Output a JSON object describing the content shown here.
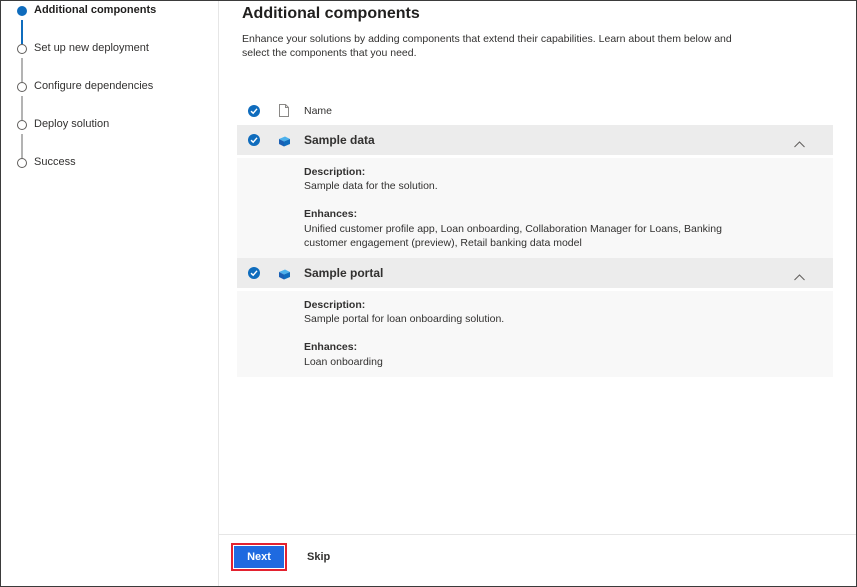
{
  "steps": [
    {
      "label": "Additional components",
      "state": "active"
    },
    {
      "label": "Set up new deployment",
      "state": "pending"
    },
    {
      "label": "Configure dependencies",
      "state": "pending"
    },
    {
      "label": "Deploy solution",
      "state": "pending"
    },
    {
      "label": "Success",
      "state": "pending"
    }
  ],
  "main": {
    "title": "Additional components",
    "description": "Enhance your solutions by adding components that extend their capabilities. Learn about them below and select the components that you need."
  },
  "table": {
    "column_name": "Name",
    "select_all_checked": true,
    "components": [
      {
        "name": "Sample data",
        "selected": true,
        "expanded": true,
        "description_label": "Description:",
        "description": "Sample data for the solution.",
        "enhances_label": "Enhances:",
        "enhances": "Unified customer profile app, Loan onboarding, Collaboration Manager for Loans, Banking customer engagement (preview), Retail banking data model"
      },
      {
        "name": "Sample portal",
        "selected": true,
        "expanded": true,
        "description_label": "Description:",
        "description": "Sample portal for loan onboarding solution.",
        "enhances_label": "Enhances:",
        "enhances": "Loan onboarding"
      }
    ]
  },
  "footer": {
    "next_label": "Next",
    "skip_label": "Skip"
  },
  "colors": {
    "accent": "#0f6cbd",
    "next_button": "#1f6ae0",
    "highlight_border": "#e3222f",
    "group_header_bg": "#ececec"
  }
}
